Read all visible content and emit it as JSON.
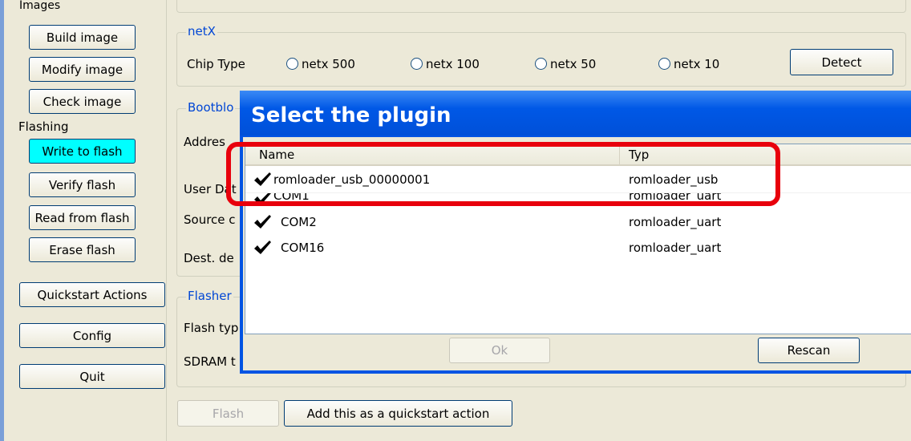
{
  "sidebar": {
    "images_heading": "Images",
    "build_image": "Build image",
    "modify_image": "Modify image",
    "check_image": "Check image",
    "flashing_heading": "Flashing",
    "write_to_flash": "Write to flash",
    "verify_flash": "Verify flash",
    "read_from_flash": "Read from flash",
    "erase_flash": "Erase flash",
    "quickstart_actions": "Quickstart Actions",
    "config": "Config",
    "quit": "Quit"
  },
  "netx": {
    "group_title": "netX",
    "chip_type_label": "Chip Type",
    "options": [
      "netx 500",
      "netx 100",
      "netx 50",
      "netx 10"
    ],
    "detect_button": "Detect"
  },
  "bootloader": {
    "group_title_partial": "Bootblo",
    "address_label_partial": "Addres",
    "user_data_label_partial": "User Dat",
    "source_label_partial": "Source c",
    "dest_label_partial": "Dest. de"
  },
  "flasher": {
    "group_title_partial": "Flasher",
    "flash_type_label_partial": "Flash typ",
    "sdram_label_partial": "SDRAM t"
  },
  "bottom": {
    "flash_button": "Flash",
    "quickstart_button": "Add this as a quickstart action"
  },
  "dialog": {
    "title": "Select the plugin",
    "columns": [
      "Name",
      "Typ"
    ],
    "rows": [
      {
        "name": "romloader_usb_00000001",
        "type": "romloader_usb"
      },
      {
        "name": "COM1",
        "type": "romloader_uart"
      },
      {
        "name": "COM2",
        "type": "romloader_uart"
      },
      {
        "name": "COM16",
        "type": "romloader_uart"
      }
    ],
    "ok_button": "Ok",
    "rescan_button": "Rescan"
  },
  "colors": {
    "window_bg": "#ece9d8",
    "dialog_title_bar": "#0054e3",
    "highlight_box": "#e8000c",
    "active_button": "#00ffff",
    "group_title": "#0046d5"
  }
}
